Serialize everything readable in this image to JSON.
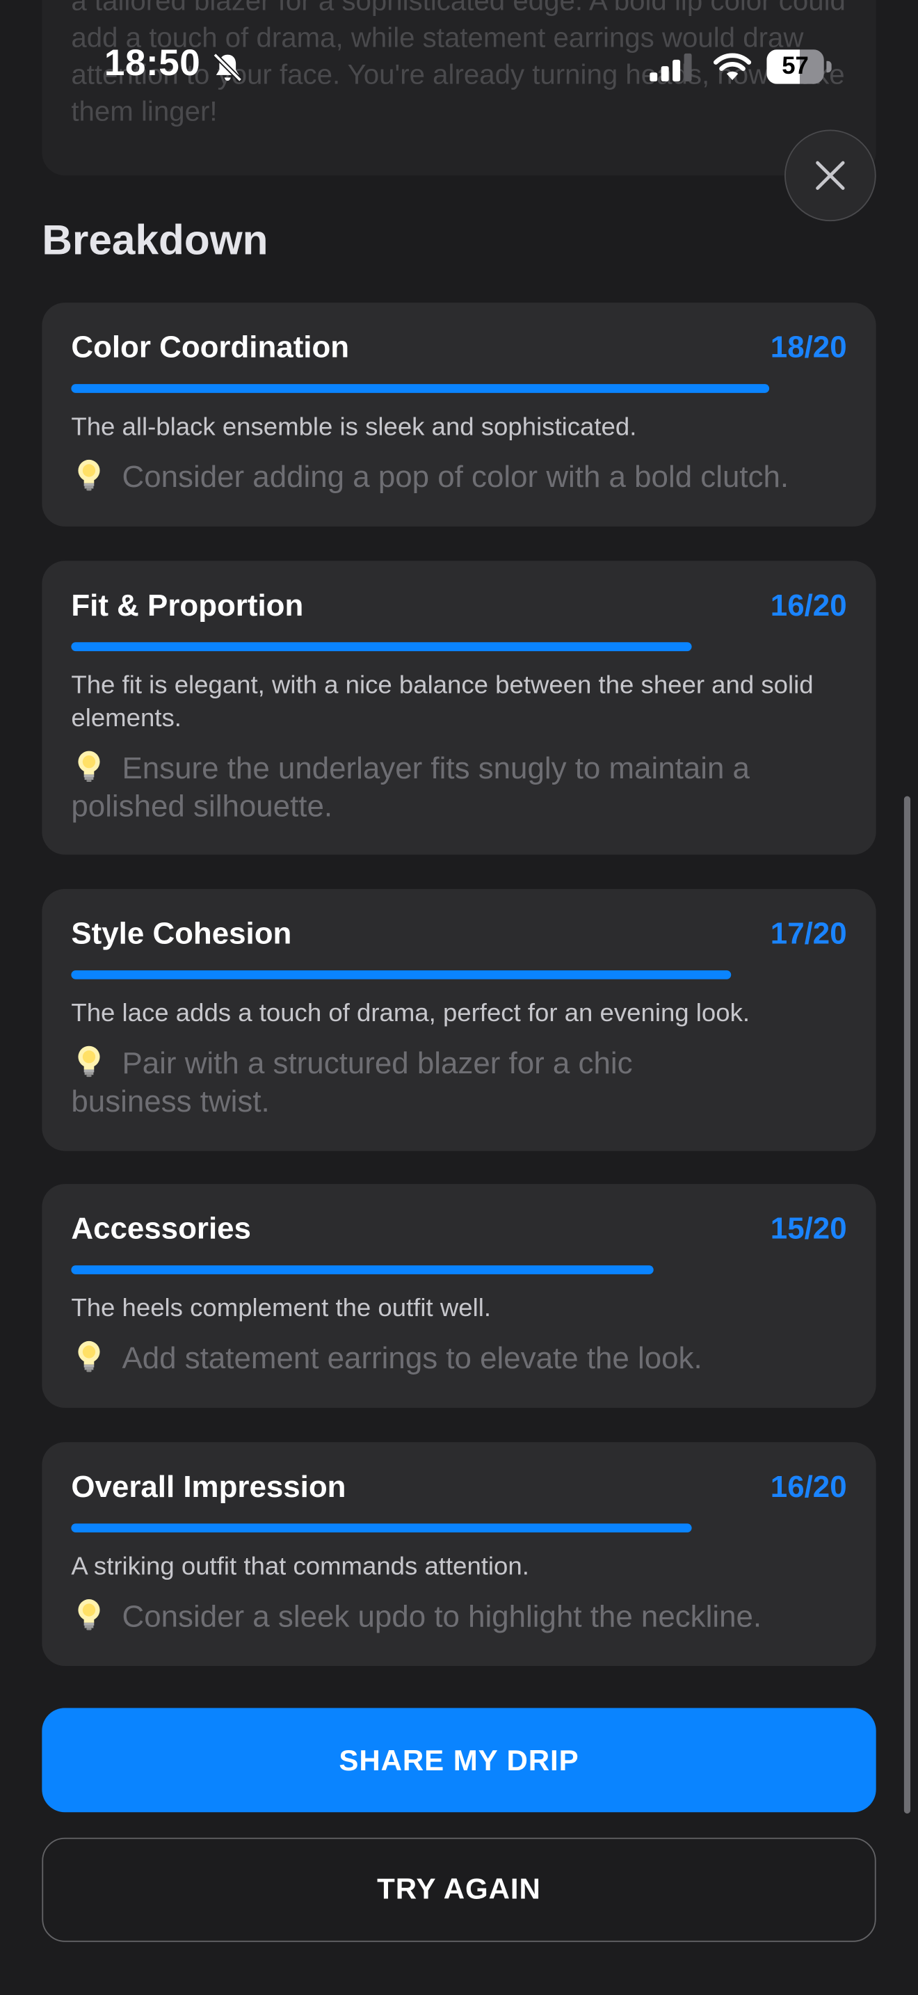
{
  "status_bar": {
    "time": "18:50",
    "battery": "57",
    "battery_level": 0.57,
    "icons": [
      "bell-slash-icon",
      "cellular-signal-icon",
      "wifi-icon",
      "battery-icon"
    ]
  },
  "summary": {
    "text": "a tailored blazer for a sophisticated edge. A bold lip color could add a touch of drama, while statement earrings would draw attention to your face. You're already turning heads, now make them linger!"
  },
  "close_icon": "close-icon",
  "breakdown": {
    "title": "Breakdown",
    "items": [
      {
        "title": "Color Coordination",
        "score": "18/20",
        "value": 18,
        "max": 20,
        "description": "The all-black ensemble is sleek and sophisticated.",
        "tip": "Consider adding a pop of color with a bold clutch."
      },
      {
        "title": "Fit & Proportion",
        "score": "16/20",
        "value": 16,
        "max": 20,
        "description": "The fit is elegant, with a nice balance between the sheer and solid elements.",
        "tip": "Ensure the underlayer fits snugly to maintain a polished silhouette."
      },
      {
        "title": "Style Cohesion",
        "score": "17/20",
        "value": 17,
        "max": 20,
        "description": "The lace adds a touch of drama, perfect for an evening look.",
        "tip": "Pair with a structured blazer for a chic business twist."
      },
      {
        "title": "Accessories",
        "score": "15/20",
        "value": 15,
        "max": 20,
        "description": "The heels complement the outfit well.",
        "tip": "Add statement earrings to elevate the look."
      },
      {
        "title": "Overall Impression",
        "score": "16/20",
        "value": 16,
        "max": 20,
        "description": "A striking outfit that commands attention.",
        "tip": "Consider a sleek updo to highlight the neckline."
      }
    ]
  },
  "actions": {
    "share_label": "SHARE MY DRIP",
    "try_again_label": "TRY AGAIN"
  },
  "colors": {
    "accent": "#0a84ff",
    "background": "#1c1c1e",
    "card": "#2c2c2e"
  }
}
